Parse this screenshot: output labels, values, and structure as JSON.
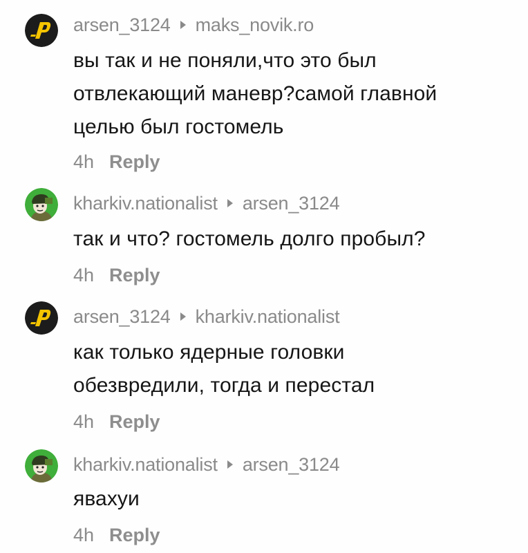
{
  "comments": [
    {
      "author": "arsen_3124",
      "reply_to": "maks_novik.ro",
      "avatar_icon": "p-logo-icon",
      "lines": [
        "вы так и не поняли,что это был",
        "отвлекающий маневр?самой главной",
        "целью был гостомель"
      ],
      "time": "4h",
      "reply_label": "Reply"
    },
    {
      "author": "kharkiv.nationalist",
      "reply_to": "arsen_3124",
      "avatar_icon": "soldier-cartoon-icon",
      "lines": [
        "так и что? гостомель долго пробыл?"
      ],
      "time": "4h",
      "reply_label": "Reply"
    },
    {
      "author": "arsen_3124",
      "reply_to": "kharkiv.nationalist",
      "avatar_icon": "p-logo-icon",
      "lines": [
        "как только ядерные головки",
        "обезвредили, тогда и перестал"
      ],
      "time": "4h",
      "reply_label": "Reply"
    },
    {
      "author": "kharkiv.nationalist",
      "reply_to": "arsen_3124",
      "avatar_icon": "soldier-cartoon-icon",
      "lines": [
        "явахуи"
      ],
      "time": "4h",
      "reply_label": "Reply"
    }
  ],
  "colors": {
    "background": "#fefefe",
    "text": "#161616",
    "meta": "#8a8a8a",
    "p_logo_bg": "#1c1c1c",
    "p_logo_fg": "#f5c400",
    "soldier_bg": "#3fae3a"
  }
}
